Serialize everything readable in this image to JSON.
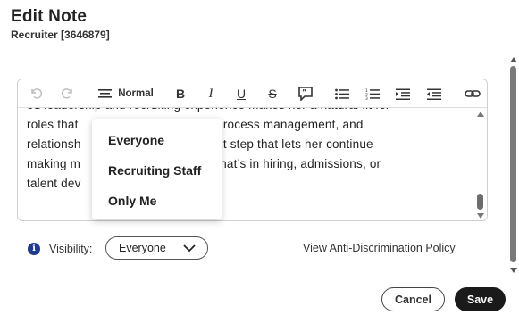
{
  "modal": {
    "title": "Edit Note",
    "subtitle": "Recruiter [3646879]"
  },
  "toolbar": {
    "undo_icon": "undo-icon",
    "redo_icon": "redo-icon",
    "paragraph_icon": "paragraph-format-icon",
    "style_label": "Normal",
    "bold_label": "B",
    "italic_label": "I",
    "underline_label": "U",
    "strike_label": "S"
  },
  "editor": {
    "lines": [
      "ed leadership and recruiting experience makes her a natural fit for",
      "roles that                       unication, process management, and",
      "relationsh                       ly for a next step that lets her continue",
      "making m                         whether that’s in hiring, admissions, or",
      "talent dev"
    ]
  },
  "visibility": {
    "label": "Visibility:",
    "selected": "Everyone",
    "options": [
      "Everyone",
      "Recruiting Staff",
      "Only Me"
    ]
  },
  "policy_link": "View Anti-Discrimination Policy",
  "footer": {
    "cancel_label": "Cancel",
    "save_label": "Save"
  },
  "colors": {
    "save_bg": "#1a1a1a",
    "info_icon": "#1f3a93"
  }
}
